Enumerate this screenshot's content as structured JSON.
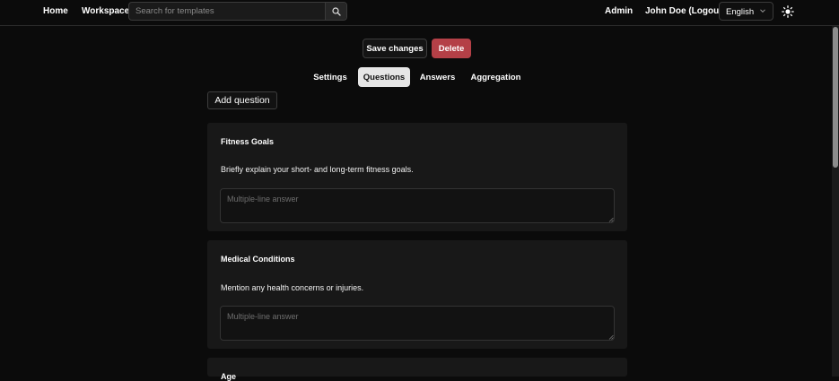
{
  "nav": {
    "home": "Home",
    "workspace": "Workspace",
    "search_placeholder": "Search for templates",
    "admin": "Admin",
    "user": "John Doe (Logout)",
    "language": "English"
  },
  "actions": {
    "save": "Save changes",
    "delete": "Delete"
  },
  "tabs": [
    "Settings",
    "Questions",
    "Answers",
    "Aggregation"
  ],
  "active_tab": "Questions",
  "add_question": "Add question",
  "questions": [
    {
      "title": "Fitness Goals",
      "description": "Briefly explain your short- and long-term fitness goals.",
      "answer_placeholder": "Multiple-line answer"
    },
    {
      "title": "Medical Conditions",
      "description": "Mention any health concerns or injuries.",
      "answer_placeholder": "Multiple-line answer"
    },
    {
      "title": "Age"
    }
  ],
  "colors": {
    "background": "#0b0b0b",
    "card": "#181818",
    "delete": "#b44047",
    "active_tab": "#e6e6e6"
  },
  "icons": [
    "search-icon",
    "chevron-down-icon",
    "sun-icon",
    "resize-grip-icon"
  ]
}
